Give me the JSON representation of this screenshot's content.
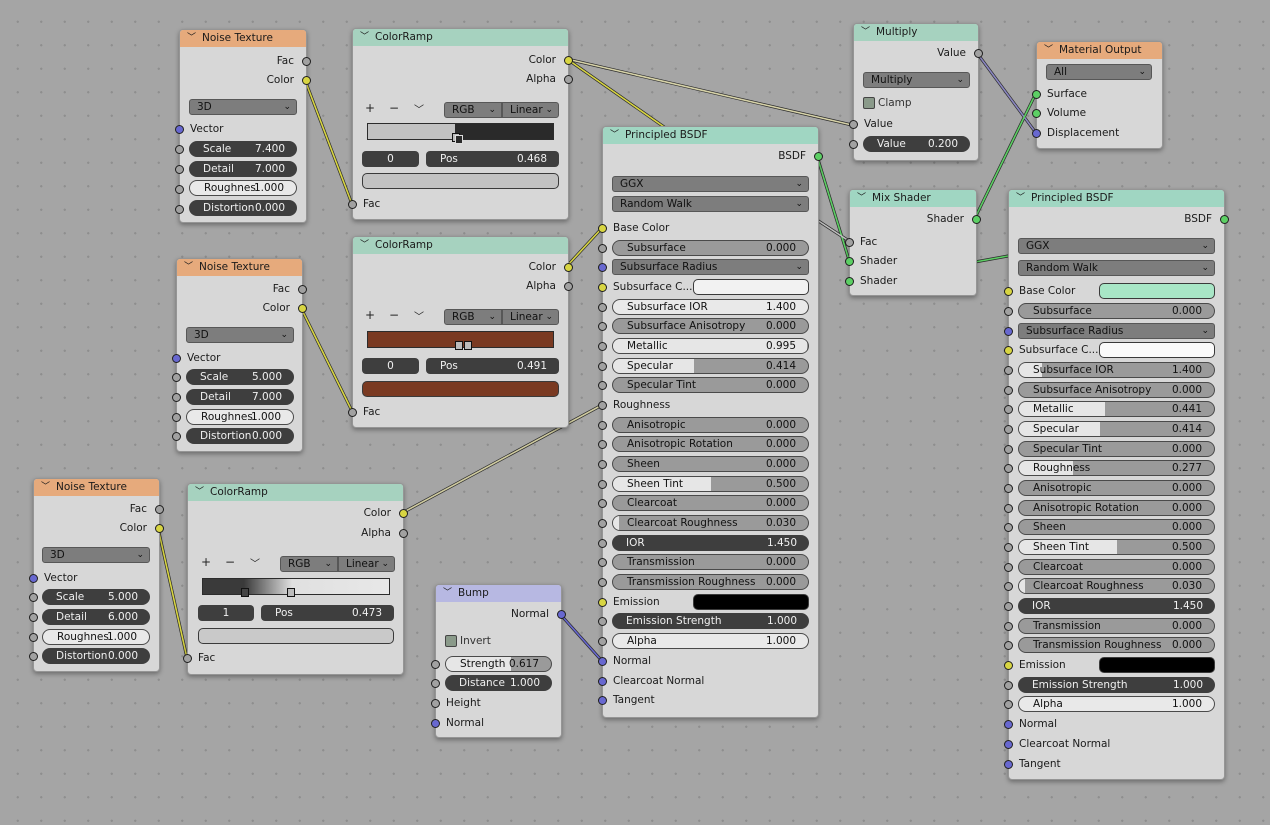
{
  "noise1": {
    "title": "Noise Texture",
    "out_fac": "Fac",
    "out_color": "Color",
    "dimensions": "3D",
    "in_vector": "Vector",
    "scale_label": "Scale",
    "scale": "7.400",
    "detail_label": "Detail",
    "detail": "7.000",
    "rough_label": "Roughnes",
    "rough": "1.000",
    "dist_label": "Distortion",
    "dist": "0.000"
  },
  "noise2": {
    "title": "Noise Texture",
    "out_fac": "Fac",
    "out_color": "Color",
    "dimensions": "3D",
    "in_vector": "Vector",
    "scale_label": "Scale",
    "scale": "5.000",
    "detail_label": "Detail",
    "detail": "7.000",
    "rough_label": "Roughnes",
    "rough": "1.000",
    "dist_label": "Distortion",
    "dist": "0.000"
  },
  "noise3": {
    "title": "Noise Texture",
    "out_fac": "Fac",
    "out_color": "Color",
    "dimensions": "3D",
    "in_vector": "Vector",
    "scale_label": "Scale",
    "scale": "5.000",
    "detail_label": "Detail",
    "detail": "6.000",
    "rough_label": "Roughnes",
    "rough": "1.000",
    "dist_label": "Distortion",
    "dist": "0.000"
  },
  "ramp1": {
    "title": "ColorRamp",
    "out_color": "Color",
    "out_alpha": "Alpha",
    "plus": "+",
    "minus": "−",
    "dropdown": "﹀",
    "mode": "RGB",
    "interp": "Linear",
    "index": "0",
    "pos_label": "Pos",
    "pos": "0.468",
    "in_fac": "Fac"
  },
  "ramp2": {
    "title": "ColorRamp",
    "out_color": "Color",
    "out_alpha": "Alpha",
    "plus": "+",
    "minus": "−",
    "dropdown": "﹀",
    "mode": "RGB",
    "interp": "Linear",
    "index": "0",
    "pos_label": "Pos",
    "pos": "0.491",
    "in_fac": "Fac"
  },
  "ramp3": {
    "title": "ColorRamp",
    "out_color": "Color",
    "out_alpha": "Alpha",
    "plus": "+",
    "minus": "−",
    "dropdown": "﹀",
    "mode": "RGB",
    "interp": "Linear",
    "index": "1",
    "pos_label": "Pos",
    "pos": "0.473",
    "in_fac": "Fac"
  },
  "multiply": {
    "title": "Multiply",
    "out_value": "Value",
    "operation": "Multiply",
    "clamp": "Clamp",
    "in_value": "Value",
    "value_label": "Value",
    "value": "0.200"
  },
  "output": {
    "title": "Material Output",
    "target": "All",
    "surface": "Surface",
    "volume": "Volume",
    "displacement": "Displacement"
  },
  "mix": {
    "title": "Mix Shader",
    "out_shader": "Shader",
    "fac": "Fac",
    "shader1": "Shader",
    "shader2": "Shader"
  },
  "bump": {
    "title": "Bump",
    "out_normal": "Normal",
    "invert": "Invert",
    "strength_label": "Strength",
    "strength": "0.617",
    "distance_label": "Distance",
    "distance": "1.000",
    "height": "Height",
    "normal": "Normal"
  },
  "bsdf1": {
    "title": "Principled BSDF",
    "out": "BSDF",
    "distribution": "GGX",
    "sss_method": "Random Walk",
    "base_color": "Base Color",
    "subsurface": "Subsurface",
    "subsurface_v": "0.000",
    "sss_radius": "Subsurface Radius",
    "sss_color": "Subsurface C...",
    "sss_ior": "Subsurface IOR",
    "sss_ior_v": "1.400",
    "sss_aniso": "Subsurface Anisotropy",
    "sss_aniso_v": "0.000",
    "metallic": "Metallic",
    "metallic_v": "0.995",
    "specular": "Specular",
    "specular_v": "0.414",
    "spec_tint": "Specular Tint",
    "spec_tint_v": "0.000",
    "roughness": "Roughness",
    "aniso": "Anisotropic",
    "aniso_v": "0.000",
    "aniso_rot": "Anisotropic Rotation",
    "aniso_rot_v": "0.000",
    "sheen": "Sheen",
    "sheen_v": "0.000",
    "sheen_tint": "Sheen Tint",
    "sheen_tint_v": "0.500",
    "clearcoat": "Clearcoat",
    "clearcoat_v": "0.000",
    "cc_rough": "Clearcoat Roughness",
    "cc_rough_v": "0.030",
    "ior": "IOR",
    "ior_v": "1.450",
    "trans": "Transmission",
    "trans_v": "0.000",
    "trans_rough": "Transmission Roughness",
    "trans_rough_v": "0.000",
    "emission": "Emission",
    "em_strength": "Emission Strength",
    "em_strength_v": "1.000",
    "alpha": "Alpha",
    "alpha_v": "1.000",
    "normal": "Normal",
    "cc_normal": "Clearcoat Normal",
    "tangent": "Tangent"
  },
  "bsdf2": {
    "title": "Principled BSDF",
    "out": "BSDF",
    "distribution": "GGX",
    "sss_method": "Random Walk",
    "base_color": "Base Color",
    "subsurface": "Subsurface",
    "subsurface_v": "0.000",
    "sss_radius": "Subsurface Radius",
    "sss_color": "Subsurface C...",
    "sss_ior": "Subsurface IOR",
    "sss_ior_v": "1.400",
    "sss_aniso": "Subsurface Anisotropy",
    "sss_aniso_v": "0.000",
    "metallic": "Metallic",
    "metallic_v": "0.441",
    "specular": "Specular",
    "specular_v": "0.414",
    "spec_tint": "Specular Tint",
    "spec_tint_v": "0.000",
    "roughness": "Roughness",
    "roughness_v": "0.277",
    "aniso": "Anisotropic",
    "aniso_v": "0.000",
    "aniso_rot": "Anisotropic Rotation",
    "aniso_rot_v": "0.000",
    "sheen": "Sheen",
    "sheen_v": "0.000",
    "sheen_tint": "Sheen Tint",
    "sheen_tint_v": "0.500",
    "clearcoat": "Clearcoat",
    "clearcoat_v": "0.000",
    "cc_rough": "Clearcoat Roughness",
    "cc_rough_v": "0.030",
    "ior": "IOR",
    "ior_v": "1.450",
    "trans": "Transmission",
    "trans_v": "0.000",
    "trans_rough": "Transmission Roughness",
    "trans_rough_v": "0.000",
    "emission": "Emission",
    "em_strength": "Emission Strength",
    "em_strength_v": "1.000",
    "alpha": "Alpha",
    "alpha_v": "1.000",
    "normal": "Normal",
    "cc_normal": "Clearcoat Normal",
    "tangent": "Tangent"
  },
  "colors": {
    "canvas": "#a5a5a5",
    "node_body": "#d7d7d7",
    "texture_header": "#e6aa7c",
    "converter_header": "#a6d2bf",
    "shader_header": "#a0d6c2",
    "vector_header": "#b7b8e2",
    "socket_float": "#a1a1a1",
    "socket_color": "#d8d542",
    "socket_vector": "#6868d0",
    "socket_shader": "#5ccf64",
    "base_color_2": "#a8e6c6",
    "ramp2_color": "#7a3a22"
  },
  "icons": {
    "collapse": "chevron-down-icon",
    "dropdown": "dropdown-arrow-icon",
    "checkbox": "checkbox-icon"
  }
}
